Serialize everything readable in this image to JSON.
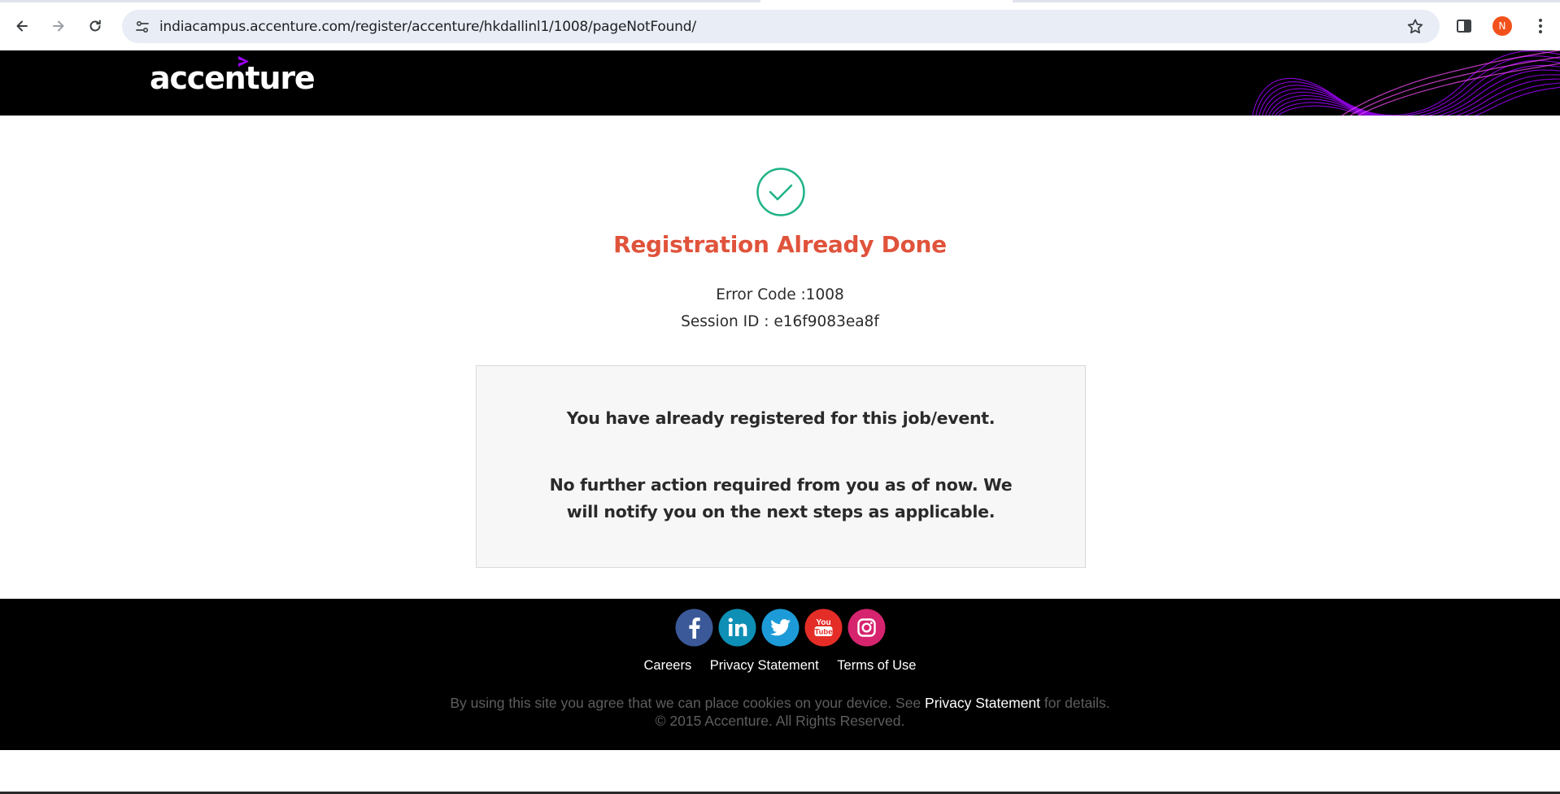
{
  "browser": {
    "url": "indiacampus.accenture.com/register/accenture/hkdallinl1/1008/pageNotFound/",
    "profile_initial": "N",
    "icons": [
      "back-arrow-icon",
      "forward-arrow-icon",
      "reload-icon",
      "site-settings-icon",
      "star-icon",
      "side-panel-icon",
      "more-vert-icon"
    ]
  },
  "header": {
    "brand": "accenture",
    "brand_color": "#a100ff"
  },
  "main": {
    "status_icon": "check-circle-icon",
    "title": "Registration Already Done",
    "error_code": "Error Code :1008",
    "session_id": "Session ID : e16f9083ea8f",
    "message_1": "You have already registered for this job/event.",
    "message_2": "No further action required from you as of now. We will notify you on the next steps as applicable.",
    "title_color": "#e0533b",
    "check_color": "#1db386"
  },
  "footer": {
    "socials": [
      "facebook-icon",
      "linkedin-icon",
      "twitter-icon",
      "youtube-icon",
      "instagram-icon"
    ],
    "links": [
      "Careers",
      "Privacy Statement",
      "Terms of Use"
    ],
    "cookie_prefix": "By using this site you agree that we can place cookies on your device. See ",
    "cookie_link": "Privacy Statement",
    "cookie_suffix": " for details.",
    "copyright": "© 2015 Accenture. All Rights Reserved."
  }
}
